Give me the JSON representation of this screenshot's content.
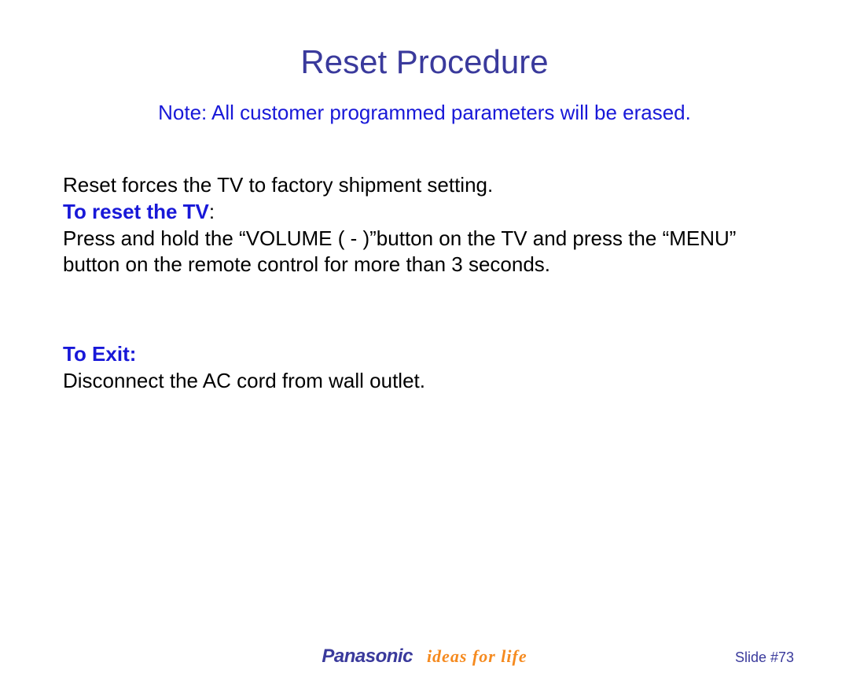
{
  "title": "Reset Procedure",
  "note": "Note: All customer programmed parameters will be erased.",
  "body": {
    "intro": "Reset forces the TV to factory shipment setting.",
    "reset_heading": "To reset the TV",
    "reset_colon": ":",
    "reset_instruction": "Press and hold the “VOLUME ( - )”button on the TV and press the “MENU” button on the remote control for more than 3 seconds.",
    "exit_heading": "To Exit:",
    "exit_instruction": "Disconnect the AC cord from wall outlet."
  },
  "footer": {
    "brand": "Panasonic",
    "tagline": "ideas for life",
    "slide_number": "Slide #73"
  }
}
